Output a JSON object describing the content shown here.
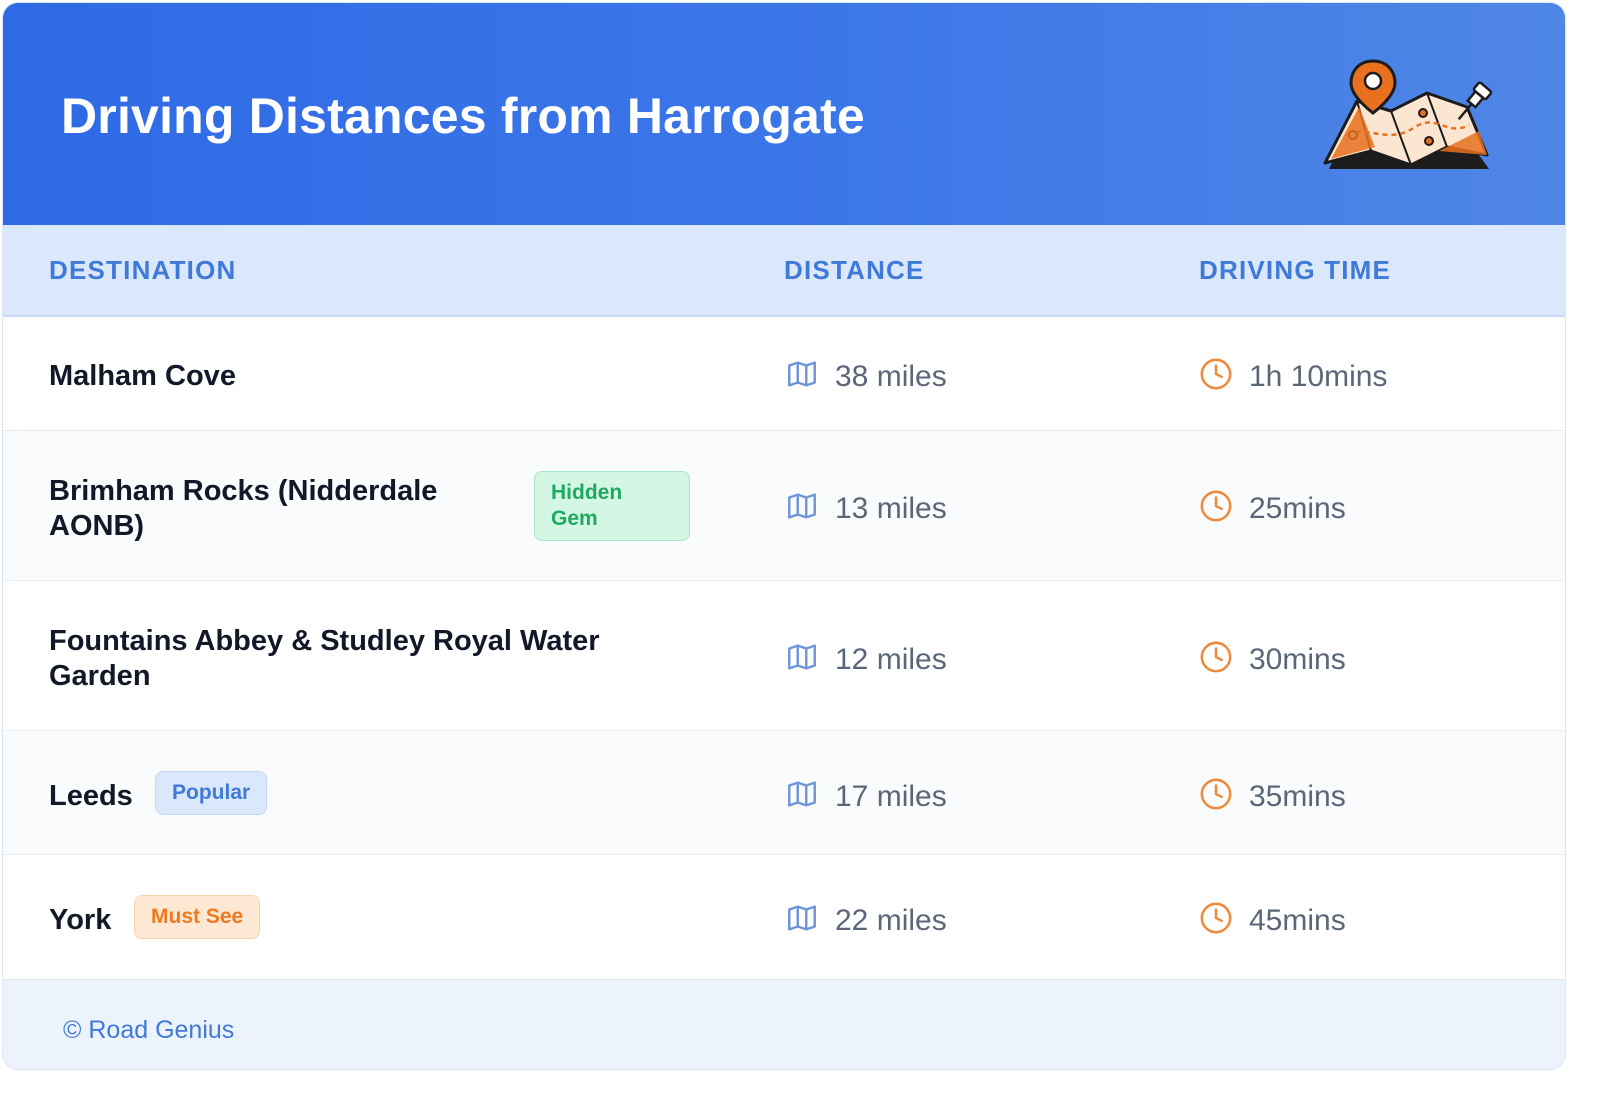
{
  "header": {
    "title": "Driving Distances from Harrogate",
    "illustration": "map-with-pins-illustration"
  },
  "table": {
    "columns": [
      "DESTINATION",
      "DISTANCE",
      "DRIVING TIME"
    ],
    "rows": [
      {
        "destination": "Malham Cove",
        "badge": null,
        "distance": "38 miles",
        "time": "1h 10mins"
      },
      {
        "destination": "Brimham Rocks (Nidderdale AONB)",
        "badge": "Hidden Gem",
        "distance": "13 miles",
        "time": "25mins"
      },
      {
        "destination": "Fountains Abbey & Studley Royal Water Garden",
        "badge": null,
        "distance": "12 miles",
        "time": "30mins"
      },
      {
        "destination": "Leeds",
        "badge": "Popular",
        "distance": "17 miles",
        "time": "35mins"
      },
      {
        "destination": "York",
        "badge": "Must See",
        "distance": "22 miles",
        "time": "45mins"
      }
    ]
  },
  "icons": {
    "distance": "map-icon",
    "time": "clock-icon"
  },
  "colors": {
    "header": "#2f6ae6",
    "accent_blue": "#3f7ad8",
    "accent_orange": "#ee7a1f",
    "accent_green": "#1faa62"
  },
  "footer": {
    "text": "© Road Genius"
  }
}
